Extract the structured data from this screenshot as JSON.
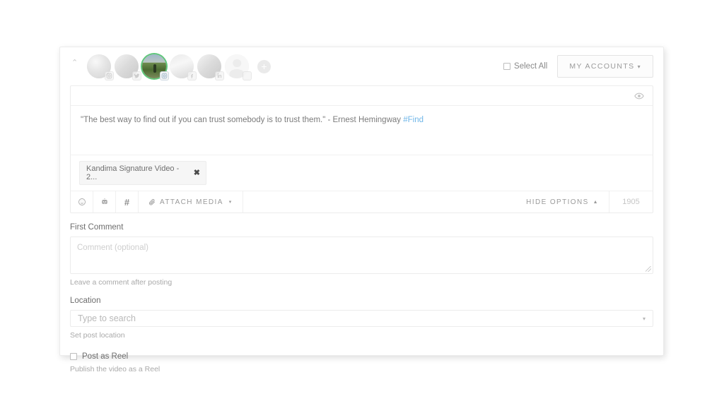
{
  "accounts_bar": {
    "collapse_caret": "⌃",
    "accounts": [
      {
        "name": "account-instagram-1",
        "network": "instagram",
        "selected": false,
        "avatar_style": "av-a"
      },
      {
        "name": "account-twitter",
        "network": "twitter",
        "selected": false,
        "avatar_style": "av-b"
      },
      {
        "name": "account-instagram-2",
        "network": "instagram",
        "selected": true,
        "avatar_style": "av-photo"
      },
      {
        "name": "account-facebook",
        "network": "facebook",
        "selected": false,
        "avatar_style": "av-c"
      },
      {
        "name": "account-linkedin",
        "network": "linkedin",
        "selected": false,
        "avatar_style": "av-b"
      },
      {
        "name": "account-empty",
        "network": "none",
        "selected": false,
        "avatar_style": "av-silhouette"
      }
    ],
    "add_account_icon": "+",
    "select_all_label": "Select All",
    "select_all_checked": false,
    "my_accounts_label": "MY ACCOUNTS",
    "my_accounts_caret": "▾"
  },
  "editor": {
    "preview_icon": "eye-icon",
    "post_text": "\"The best way to find out if you can trust somebody is to trust them.\" - Ernest Hemingway ",
    "post_hashtag": "#Find",
    "media_chip_label": "Kandima Signature Video - 2...",
    "media_chip_remove": "✖",
    "toolbar": {
      "emoji_icon": "emoji-icon",
      "ai_icon": "ai-robot-icon",
      "hashtag_icon": "#",
      "attach_media_label": "ATTACH MEDIA",
      "attach_media_caret": "▾",
      "hide_options_label": "HIDE OPTIONS",
      "hide_options_caret": "▲",
      "character_count": "1905"
    }
  },
  "options": {
    "first_comment": {
      "label": "First Comment",
      "placeholder": "Comment (optional)",
      "value": "",
      "help": "Leave a comment after posting"
    },
    "location": {
      "label": "Location",
      "placeholder": "Type to search",
      "value": "",
      "caret": "▾",
      "help": "Set post location"
    },
    "post_as_reel": {
      "label": "Post as Reel",
      "checked": false,
      "help": "Publish the video as a Reel"
    }
  },
  "colors": {
    "accent_link": "#6fb6e8",
    "selected_ring": "#5fc77a",
    "border": "#ececec",
    "text": "#6d6d6d",
    "muted": "#a9a9a9"
  }
}
